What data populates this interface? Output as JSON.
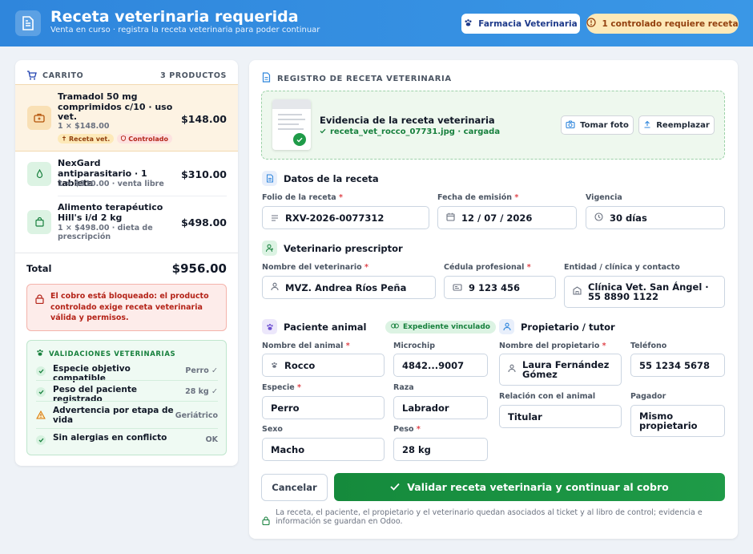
{
  "header": {
    "title": "Receta veterinaria requerida",
    "subtitle": "Venta en curso · registra la receta veterinaria para poder continuar",
    "pharmacy_button": "Farmacia Veterinaria",
    "controlled_badge": "1 controlado requiere receta"
  },
  "cart": {
    "label": "CARRITO",
    "count": "3 PRODUCTOS",
    "items": [
      {
        "name": "Tramadol 50 mg comprimidos c/10 · uso vet.",
        "meta": "1 × $148.00",
        "price": "$148.00",
        "tags": [
          "Receta vet.",
          "Controlado"
        ]
      },
      {
        "name": "NexGard antiparasitario · 1 tableta",
        "meta": "1 × $310.00 · venta libre",
        "price": "$310.00"
      },
      {
        "name": "Alimento terapéutico Hill's i/d 2 kg",
        "meta": "1 × $498.00 · dieta de prescripción",
        "price": "$498.00"
      }
    ],
    "total_label": "Total",
    "total_value": "$956.00",
    "alert": "El cobro está bloqueado: el producto controlado exige receta veterinaria válida y permisos.",
    "validations": {
      "title": "VALIDACIONES VETERINARIAS",
      "rows": [
        {
          "label": "Especie objetivo compatible",
          "value": "Perro ✓"
        },
        {
          "label": "Peso del paciente registrado",
          "value": "28 kg ✓"
        },
        {
          "label": "Advertencia por etapa de vida",
          "value": "Geriátrico"
        },
        {
          "label": "Sin alergias en conflicto",
          "value": "OK"
        }
      ]
    }
  },
  "form": {
    "title": "REGISTRO DE RECETA VETERINARIA",
    "evidence": {
      "title": "Evidencia de la receta veterinaria",
      "file": "receta_vet_rocco_07731.jpg · cargada",
      "take_photo": "Tomar foto",
      "replace": "Reemplazar"
    },
    "prescription": {
      "title": "Datos de la receta",
      "folio_label": "Folio de la receta",
      "folio_value": "RXV-2026-0077312",
      "date_label": "Fecha de emisión",
      "date_value": "12 / 07 / 2026",
      "validity_label": "Vigencia",
      "validity_value": "30 días"
    },
    "vet": {
      "title": "Veterinario prescriptor",
      "name_label": "Nombre del veterinario",
      "name_value": "MVZ. Andrea Ríos Peña",
      "license_label": "Cédula profesional",
      "license_value": "9 123 456",
      "clinic_label": "Entidad / clínica y contacto",
      "clinic_value": "Clínica Vet. San Ángel · 55 8890 1122"
    },
    "patient": {
      "title": "Paciente animal",
      "linked": "Expediente vinculado",
      "name_label": "Nombre del animal",
      "name_value": "Rocco",
      "chip_label": "Microchip",
      "chip_value": "4842...9007",
      "species_label": "Especie",
      "species_value": "Perro",
      "breed_label": "Raza",
      "breed_value": "Labrador",
      "sex_label": "Sexo",
      "sex_value": "Macho",
      "weight_label": "Peso",
      "weight_value": "28 kg"
    },
    "owner": {
      "title": "Propietario / tutor",
      "name_label": "Nombre del propietario",
      "name_value": "Laura Fernández Gómez",
      "phone_label": "Teléfono",
      "phone_value": "55 1234 5678",
      "relation_label": "Relación con el animal",
      "relation_value": "Titular",
      "payer_label": "Pagador",
      "payer_value": "Mismo propietario"
    },
    "required_mark": "*",
    "cancel": "Cancelar",
    "validate": "Validar receta veterinaria y continuar al cobro",
    "footnote": "La receta, el paciente, el propietario y el veterinario quedan asociados al ticket y al libro de control; evidencia e información se guardan en Odoo."
  }
}
